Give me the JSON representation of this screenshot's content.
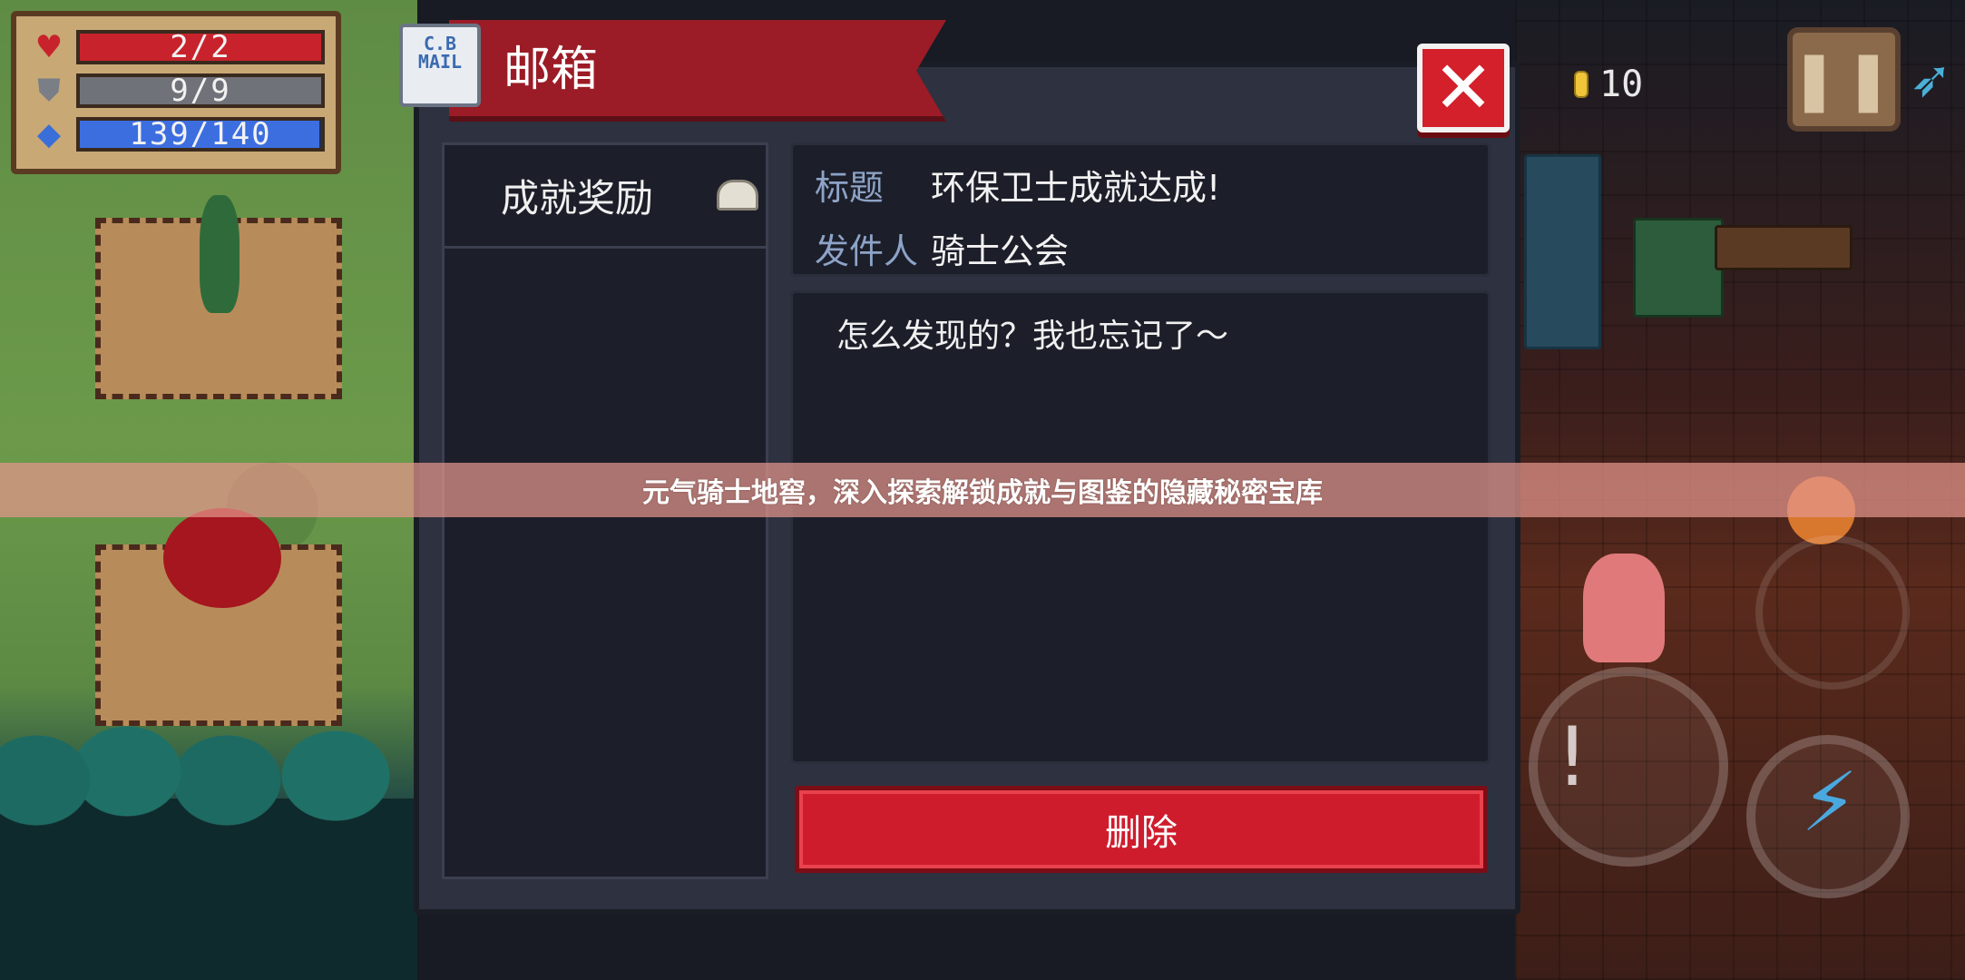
{
  "hud": {
    "hp": {
      "text": "2/2",
      "fill": 1.0
    },
    "armor": {
      "text": "9/9",
      "fill": 1.0
    },
    "energy": {
      "text": "139/140",
      "fill": 0.993
    },
    "coins": "10",
    "map_icon": "bow-icon"
  },
  "mailbox": {
    "title": "邮箱",
    "mail_icon_label": "C.B\nMAIL",
    "items": [
      {
        "label": "成就奖励"
      }
    ],
    "header": {
      "subject_label": "标题",
      "subject_value": "环保卫士成就达成!",
      "sender_label": "发件人",
      "sender_value": "骑士公会"
    },
    "body": "怎么发现的？我也忘记了～",
    "delete_label": "删除"
  },
  "caption": "元气骑士地窖，深入探索解锁成就与图鉴的隐藏秘密宝库",
  "colors": {
    "ribbon": "#9b1c26",
    "close": "#d3202b",
    "delete": "#cf1c2d",
    "label_blue": "#8da3c7",
    "panel": "#2e313f"
  }
}
